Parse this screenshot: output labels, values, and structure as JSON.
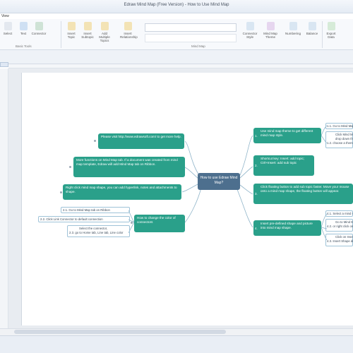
{
  "window": {
    "title": "Edraw Mind Map (Free Version) - How to Use Mind Map"
  },
  "menu": {
    "first": "View"
  },
  "ribbon": {
    "buttons": [
      {
        "label": "Select"
      },
      {
        "label": "Text"
      },
      {
        "label": "Connector"
      },
      {
        "label": "Insert Topic"
      },
      {
        "label": "Insert Subtopic"
      },
      {
        "label": "Add Multiple Topics"
      },
      {
        "label": "Insert Relationship"
      },
      {
        "label": "Connector Style"
      },
      {
        "label": "Mind Map Theme"
      },
      {
        "label": "Numbering"
      },
      {
        "label": "Balance"
      },
      {
        "label": "Export Data"
      }
    ],
    "groups": {
      "basic_tools": "Basic Tools",
      "mind_map": "Mind Map"
    }
  },
  "map": {
    "central": "How to use Edraw Mind Map?",
    "left": [
      {
        "text": "Please visit http://www.edrawsoft.com/ to get more help."
      },
      {
        "text": "More functions on Mind Map tab. If a document was created from mind map template, Edraw will add Mind Map tab on Ribbon."
      },
      {
        "text": "Right click mind map shape, you can add hyperlink, notes and attachments to shape."
      },
      {
        "text": "How to change the color of connectors"
      }
    ],
    "left_subtopics": [
      "2.1. Go to Mind Map tab on Ribbon",
      "2.2. Click Link Connector to default connection",
      "Select the connector,",
      "2.3. go to Home tab, Line tab, Line color"
    ],
    "right": [
      {
        "num": "1.",
        "text": "Use mind map theme to get different mind map style."
      },
      {
        "num": "2.",
        "text": "Shortcut key: Insert: add topic; Ctrl+Insert: add sub topic"
      },
      {
        "num": "3.",
        "text": "Click floating button to add sub topic faster. Move your mouse onto a mind map shape, the floating button will appear."
      },
      {
        "num": "4.",
        "text": "Insert pre-defined shape and picture into mind map shape."
      }
    ],
    "right_subtopics": [
      "1.1. Go to Mind Map tab",
      "Click Mind Map Theme,",
      "drop down the",
      "1.2. choose a theme",
      "4.1. Select a mind map shape",
      "Go to Mind Map tab",
      "4.2. or right click on shape",
      "Click on Insert Shape",
      "4.3. Insert Shape dialog"
    ]
  },
  "colors": {
    "topic": "#2aa08a",
    "central": "#4d6f8e",
    "connector": "#8fb4c9",
    "subtopic_border": "#9fc3d8"
  },
  "icons": [
    "select-icon",
    "text-icon",
    "connector-icon",
    "insert-topic-icon",
    "insert-subtopic-icon",
    "add-multiple-icon",
    "relationship-icon",
    "connector-style-icon",
    "theme-icon",
    "numbering-icon",
    "balance-icon",
    "export-icon"
  ]
}
